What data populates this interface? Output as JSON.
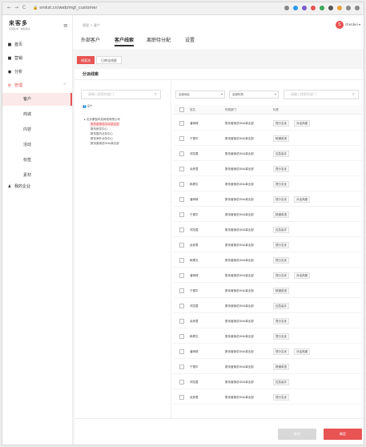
{
  "browser": {
    "back": "←",
    "forward": "→",
    "reload": "C",
    "url": "smkst.cn/web/mgt_customer",
    "extension_colors": [
      "#888888",
      "#2b9bf4",
      "#7a5cc9",
      "#e85353",
      "#3aa657",
      "#555555",
      "#e8a23a",
      "#888888",
      "#888888"
    ]
  },
  "sidebar": {
    "logo_title": "来客多",
    "logo_subtitle": "来客私域 · 赚钱更多",
    "collapse_icon": "≡",
    "items": [
      {
        "icon": "home-icon",
        "glyph": "■",
        "label": "首页"
      },
      {
        "icon": "marketing-icon",
        "glyph": "■",
        "label": "营销"
      },
      {
        "icon": "analytics-icon",
        "glyph": "●",
        "label": "分析"
      },
      {
        "icon": "settings-gear-icon",
        "glyph": "⚙",
        "label": "管理",
        "expanded": true
      }
    ],
    "sub_items": [
      {
        "label": "客户",
        "active": true
      },
      {
        "label": "商城"
      },
      {
        "label": "内容"
      },
      {
        "label": "活动"
      },
      {
        "label": "标签"
      },
      {
        "label": "素材"
      }
    ],
    "enterprise": {
      "icon": "user-icon",
      "glyph": "♟",
      "label": "我的企业"
    }
  },
  "header": {
    "breadcrumb": "管理 > 客户",
    "user_name": "chenbei",
    "user_avatar": "S",
    "tabs": [
      {
        "label": "外部客户"
      },
      {
        "label": "客户线索",
        "active": true
      },
      {
        "label": "离职待分配"
      },
      {
        "label": "设置"
      }
    ]
  },
  "mode_buttons": [
    {
      "label": "线索池",
      "active": true
    },
    {
      "label": "已转化线索"
    }
  ],
  "section_title": "分派线索",
  "dept": {
    "search_placeholder": "请输入搜索的部门",
    "member_count": "8个",
    "tree": [
      {
        "label": "▸ 北京微智科技网络有限公司",
        "level": 0
      },
      {
        "label": "数传营销总DNA事业部",
        "level": 1,
        "selected": true
      },
      {
        "label": "数传研发中心",
        "level": 1
      },
      {
        "label": "数传国内业务中心",
        "level": 1
      },
      {
        "label": "数传海外业务中心",
        "level": 1
      },
      {
        "label": "数传营销总DNA事业部",
        "level": 1
      }
    ]
  },
  "filters": {
    "region": "全部地区",
    "tag": "全部标签",
    "name_placeholder": "请输入搜索的部门"
  },
  "table": {
    "headers": [
      "姓名",
      "所属部门",
      "标签"
    ],
    "rows": [
      {
        "name": "潘玥琦",
        "dept": "数传营销总DNA事业部",
        "tags": [
          "提分名优",
          "对话风趣"
        ]
      },
      {
        "name": "于德华",
        "dept": "数传营销总DNA事业部",
        "tags": [
          "精通英语"
        ]
      },
      {
        "name": "邓凯茵",
        "dept": "数传营销总DNA事业部",
        "tags": [
          "应急高手"
        ]
      },
      {
        "name": "余彦君",
        "dept": "数传营销总DNA事业部",
        "tags": [
          "提分名优"
        ]
      },
      {
        "name": "韩博文",
        "dept": "数传营销总DNA事业部",
        "tags": [
          "提分名优"
        ]
      },
      {
        "name": "潘玥琦",
        "dept": "数传营销总DNA事业部",
        "tags": [
          "提分名优",
          "对话风趣"
        ]
      },
      {
        "name": "于德华",
        "dept": "数传营销总DNA事业部",
        "tags": [
          "精通英语"
        ]
      },
      {
        "name": "邓凯茵",
        "dept": "数传营销总DNA事业部",
        "tags": [
          "应急高手"
        ]
      },
      {
        "name": "余彦君",
        "dept": "数传营销总DNA事业部",
        "tags": [
          "提分名优"
        ]
      },
      {
        "name": "韩博文",
        "dept": "数传营销总DNA事业部",
        "tags": [
          "提分名优"
        ]
      },
      {
        "name": "潘玥琦",
        "dept": "数传营销总DNA事业部",
        "tags": [
          "提分名优",
          "对话风趣"
        ]
      },
      {
        "name": "于德华",
        "dept": "数传营销总DNA事业部",
        "tags": [
          "精通英语"
        ]
      },
      {
        "name": "邓凯茵",
        "dept": "数传营销总DNA事业部",
        "tags": [
          "应急高手"
        ]
      },
      {
        "name": "余彦君",
        "dept": "数传营销总DNA事业部",
        "tags": [
          "提分名优"
        ]
      },
      {
        "name": "韩博文",
        "dept": "数传营销总DNA事业部",
        "tags": [
          "提分名优"
        ]
      },
      {
        "name": "潘玥琦",
        "dept": "数传营销总DNA事业部",
        "tags": [
          "提分名优",
          "对话风趣"
        ]
      },
      {
        "name": "于德华",
        "dept": "数传营销总DNA事业部",
        "tags": [
          "精通英语"
        ]
      },
      {
        "name": "邓凯茵",
        "dept": "数传营销总DNA事业部",
        "tags": [
          "应急高手"
        ]
      },
      {
        "name": "余彦君",
        "dept": "数传营销总DNA事业部",
        "tags": [
          "提分名优"
        ]
      }
    ]
  },
  "footer": {
    "cancel": "取消",
    "confirm": "确定"
  }
}
